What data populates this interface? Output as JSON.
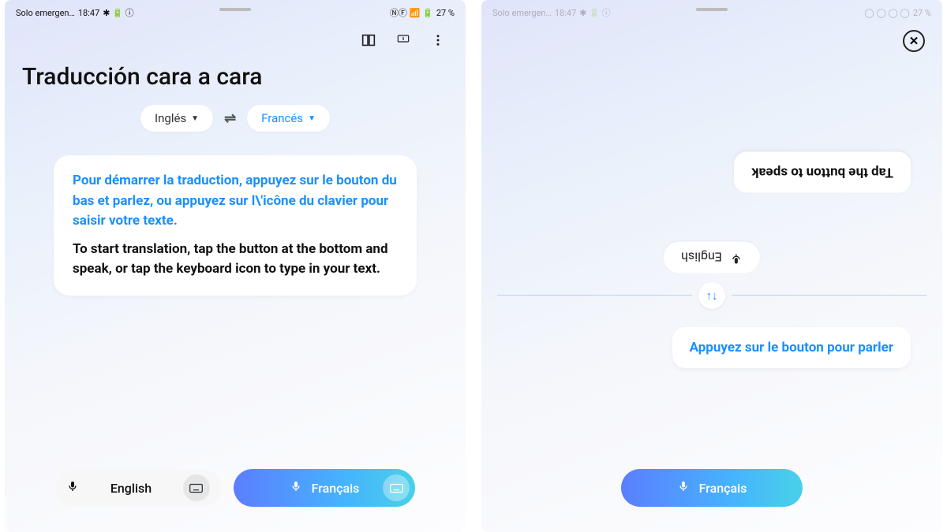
{
  "status": {
    "carrier": "Solo emergen…",
    "time": "18:47",
    "battery_text": "27 %",
    "indicators_left": "⚙ ⓘ ⊘",
    "indicators_right": "✕◯ ⓃⒻ 🜨📶🔲"
  },
  "left": {
    "title": "Traducción cara a cara",
    "source_lang": "Inglés",
    "target_lang": "Francés",
    "instruction_fr": "Pour démarrer la traduction, appuyez sur le bouton du bas et parlez, ou appuyez sur l\\'icône du clavier pour saisir votre texte.",
    "instruction_en": "To start translation, tap the button at the bottom and speak, or tap the keyboard icon to type in your text.",
    "mic_src_label": "English",
    "mic_tgt_label": "Français"
  },
  "right": {
    "top_lang": "English",
    "top_bubble": "Tap the button to speak",
    "bottom_bubble": "Appuyez sur le bouton pour parler",
    "bottom_lang": "Français"
  },
  "colors": {
    "accent": "#1890ff",
    "grad_start": "#5b7eff",
    "grad_end": "#49d1e8"
  }
}
